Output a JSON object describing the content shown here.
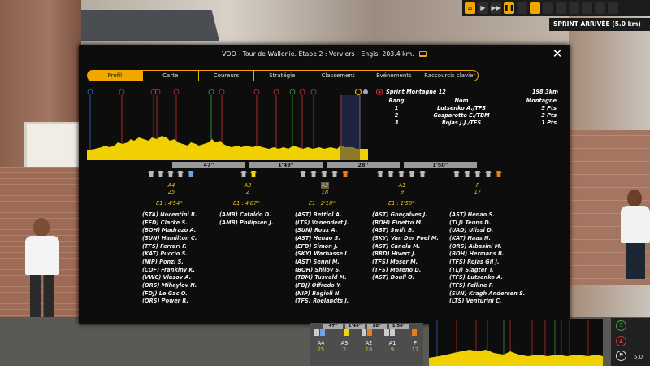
{
  "toolbar": {
    "buttons": [
      "⌂",
      "▶",
      "▶▶",
      "❚❚"
    ],
    "sprint_label": "SPRINT ARRIVÉE (5.0 km)"
  },
  "dialog": {
    "title": "VOO - Tour de Wallonie. Étape 2 : Verviers - Engis. 203.4 km.",
    "tabs": [
      {
        "label": "Profil",
        "active": true
      },
      {
        "label": "Carte"
      },
      {
        "label": "Coureurs"
      },
      {
        "label": "Stratégie"
      },
      {
        "label": "Classement"
      },
      {
        "label": "Evénements"
      },
      {
        "label": "Raccourcis clavier"
      }
    ]
  },
  "sprint_info": {
    "title": "Sprint Montagne 12",
    "distance": "198.3km",
    "headers": {
      "rank": "Rang",
      "name": "Nom",
      "mountain": "Montagne"
    },
    "rows": [
      {
        "rank": "1",
        "name": "Lutsenko A./TFS",
        "pts": "5 Pts"
      },
      {
        "rank": "2",
        "name": "Gasparotto E./TBM",
        "pts": "3 Pts"
      },
      {
        "rank": "3",
        "name": "Rojas J.J./TFS",
        "pts": "1 Pts"
      }
    ]
  },
  "gaps": [
    "47''",
    "1'49''",
    "28''",
    "1'50''"
  ],
  "groups": [
    {
      "label": "A4",
      "count": "25",
      "time": "E1 : 4'54''",
      "riders": [
        "(STA) Nocentini R.",
        "(EFD) Clarke S.",
        "(BOH) Madrazo A.",
        "(SUN) Hamilton C.",
        "(TFS) Ferrari F.",
        "(KAT) Puccio S.",
        "(NIP) Ponzi S.",
        "(COF) Frankiny K.",
        "(VWC) Vlasov A.",
        "(ORS) Mihaylov N.",
        "(FDJ) Le Gac O.",
        "(ORS) Power R."
      ]
    },
    {
      "label": "A3",
      "count": "2",
      "time": "E1 : 4'07''",
      "riders": [
        "(AMB) Cataldo D.",
        "(AMB) Philipsen J."
      ]
    },
    {
      "label": "A2",
      "count": "18",
      "time": "E1 : 2'18''",
      "riders": [
        "(AST) Bettiol A.",
        "(LTS) Vanendert J.",
        "(SUN) Roux A.",
        "(AST) Henao S.",
        "(EFD) Simon J.",
        "(SKY) Warbasse L.",
        "(AST) Senni M.",
        "(BOH) Shilov S.",
        "(TBM) Tusveld M.",
        "(FDJ) Offredo Y.",
        "(NIP) Bagioli N.",
        "(TFS) Roelandts J."
      ]
    },
    {
      "label": "A1",
      "count": "9",
      "time": "E1 : 1'50''",
      "riders": [
        "(AST) Gonçalves J.",
        "(BOH) Finetto M.",
        "(AST) Swift B.",
        "(SKY) Van Der Poel M.",
        "(AST) Canola M.",
        "(BRD) Hivert J.",
        "(TFS) Moser M.",
        "(TFS) Moreno D.",
        "(AST) Doull O."
      ]
    },
    {
      "label": "P",
      "count": "17",
      "time": "",
      "riders": [
        "(AST) Henao S.",
        "(TLJ) Teuns D.",
        "(UAD) Ulissi D.",
        "(KAT) Haas N.",
        "(ORS) Albasini M.",
        "(BOH) Hermans B.",
        "(TFS) Rojas Gil J.",
        "(TLJ) Slagter T.",
        "(TFS) Lutsenko A.",
        "(TFS) Felline F.",
        "(SUN) Kragh Andersen S.",
        "(LTS) Venturini C."
      ]
    }
  ],
  "mini": {
    "gaps": [
      "47''",
      "1'49''",
      "28''",
      "1'50''"
    ],
    "labels": [
      "A4",
      "A3",
      "A2",
      "A1",
      "P"
    ],
    "counts": [
      "25",
      "2",
      "18",
      "9",
      "17"
    ]
  },
  "side_hud": {
    "value": "5.0"
  },
  "colors": {
    "accent": "#f0a800",
    "profile": "#f0d000",
    "climb_line": "#d23030",
    "sprint_line": "#3aa83a",
    "dialog_bg": "#0d0d0d"
  }
}
